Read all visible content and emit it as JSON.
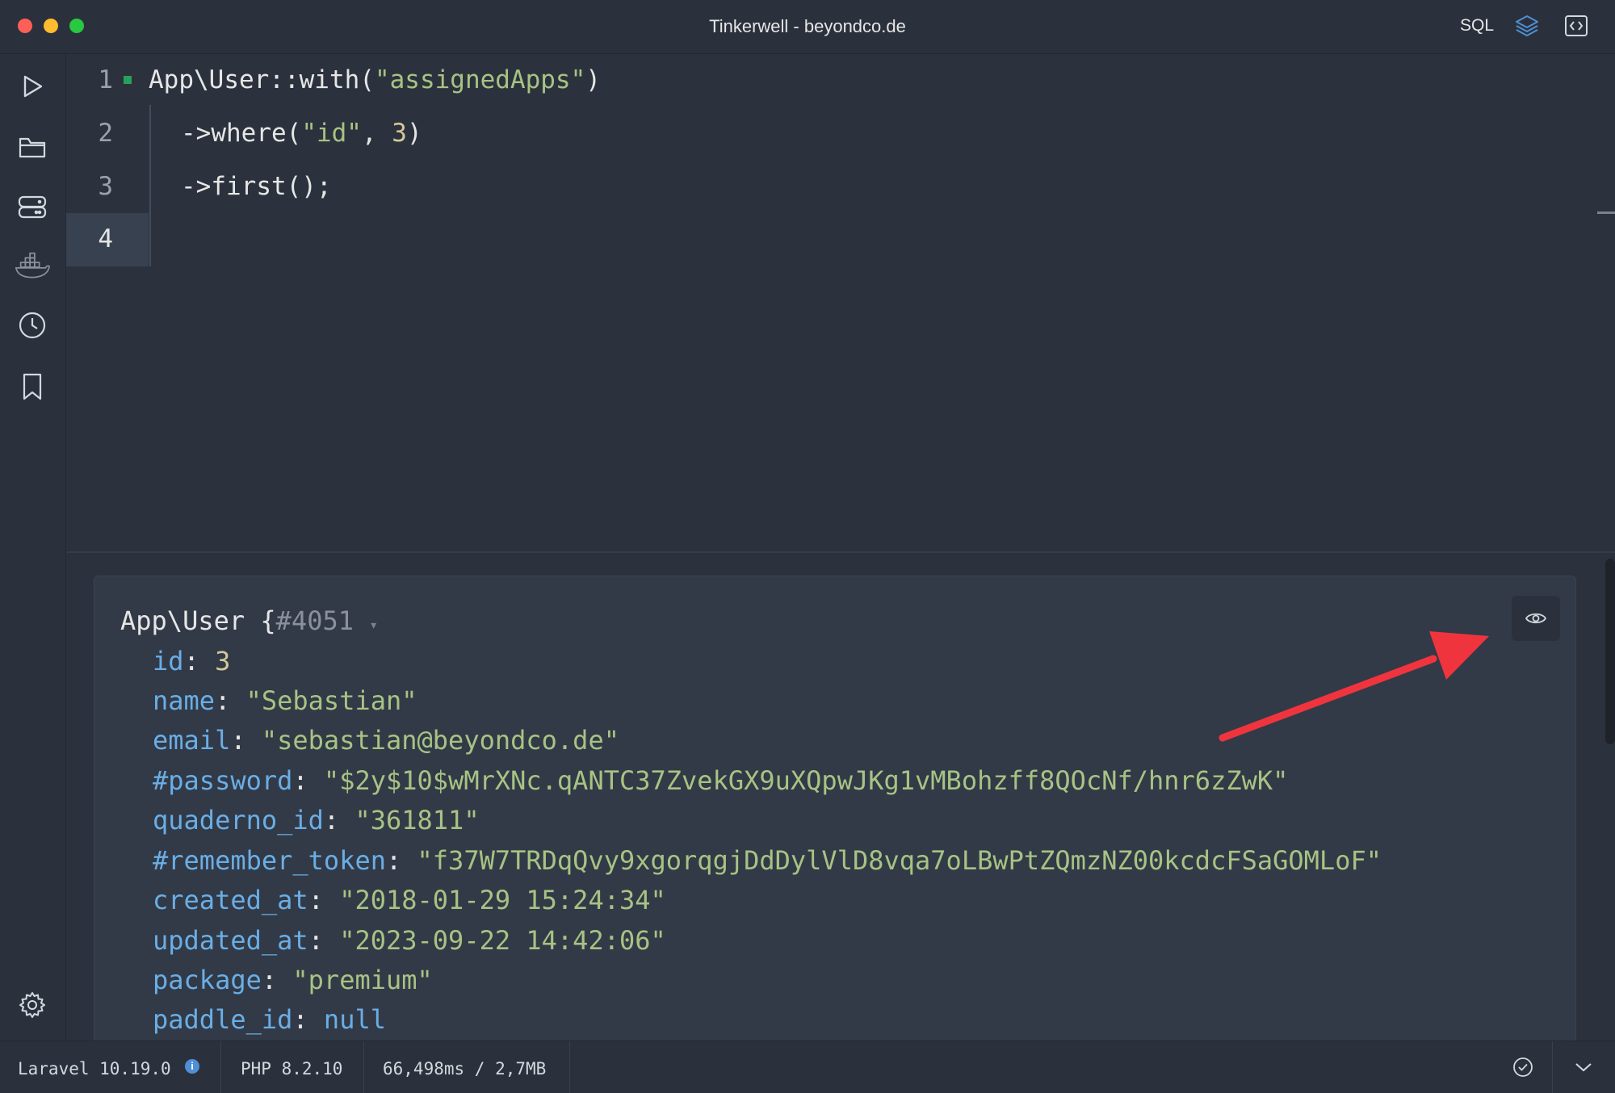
{
  "window": {
    "title": "Tinkerwell - beyondco.de",
    "sql_label": "SQL"
  },
  "sidebar": {
    "items": [
      {
        "icon": "play-icon"
      },
      {
        "icon": "folder-icon"
      },
      {
        "icon": "database-icon"
      },
      {
        "icon": "docker-icon"
      },
      {
        "icon": "history-icon"
      },
      {
        "icon": "bookmark-icon"
      }
    ],
    "settings_icon": "gear-icon"
  },
  "editor": {
    "line_numbers": [
      "1",
      "2",
      "3",
      "4"
    ],
    "lines": [
      {
        "code": "App\\User::with(",
        "string": "\"assignedApps\"",
        "tail": ")"
      },
      {
        "code": "->where(",
        "string": "\"id\"",
        "mid": ", ",
        "number": "3",
        "tail": ")"
      },
      {
        "code": "->first();"
      }
    ]
  },
  "output": {
    "class_name": "App\\User",
    "brace": " {",
    "object_id": "#4051",
    "fields": [
      {
        "key": "id",
        "value": "3",
        "kind": "number"
      },
      {
        "key": "name",
        "value": "\"Sebastian\"",
        "kind": "string"
      },
      {
        "key": "email",
        "value": "\"sebastian@beyondco.de\"",
        "kind": "string"
      },
      {
        "key": "#password",
        "value": "\"$2y$10$wMrXNc.qANTC37ZvekGX9uXQpwJKg1vMBohzff8QOcNf/hnr6zZwK\"",
        "kind": "string"
      },
      {
        "key": "quaderno_id",
        "value": "\"361811\"",
        "kind": "string"
      },
      {
        "key": "#remember_token",
        "value": "\"f37W7TRDqQvy9xgorqgjDdDylVlD8vqa7oLBwPtZQmzNZ00kcdcFSaGOMLoF\"",
        "kind": "string"
      },
      {
        "key": "created_at",
        "value": "\"2018-01-29 15:24:34\"",
        "kind": "string"
      },
      {
        "key": "updated_at",
        "value": "\"2023-09-22 14:42:06\"",
        "kind": "string"
      },
      {
        "key": "package",
        "value": "\"premium\"",
        "kind": "string"
      },
      {
        "key": "paddle_id",
        "value": "null",
        "kind": "null"
      }
    ]
  },
  "statusbar": {
    "laravel": "Laravel 10.19.0",
    "info_glyph": "i",
    "php": "PHP 8.2.10",
    "metrics": "66,498ms / 2,7MB"
  },
  "colors": {
    "accent_red": "#f0343e",
    "string": "#a7c384",
    "key": "#6aaee6",
    "number": "#d3c89a"
  }
}
